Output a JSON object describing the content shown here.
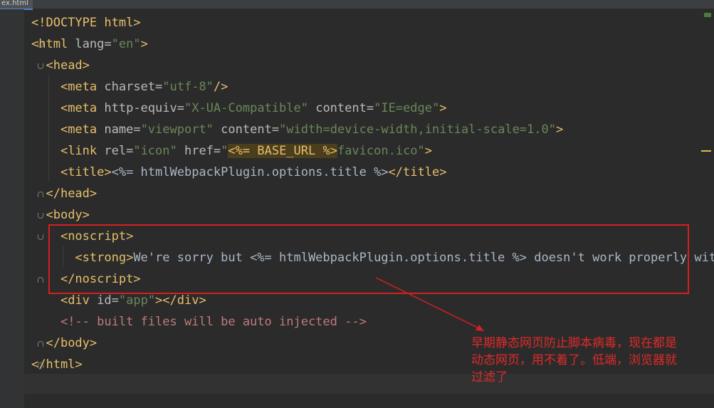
{
  "tab": {
    "label": "ex.html"
  },
  "lines": [
    {
      "parts": [
        [
          "tag",
          "<!DOCTYPE "
        ],
        [
          "tag",
          "html"
        ],
        [
          "tag",
          ">"
        ]
      ]
    },
    {
      "parts": [
        [
          "tag",
          "<html "
        ],
        [
          "attr",
          "lang="
        ],
        [
          "val",
          "\"en\""
        ],
        [
          "tag",
          ">"
        ]
      ]
    },
    {
      "parts": [
        [
          "plain",
          "  "
        ],
        [
          "tag",
          "<head>"
        ]
      ]
    },
    {
      "parts": [
        [
          "plain",
          "    "
        ],
        [
          "tag",
          "<meta "
        ],
        [
          "attr",
          "charset="
        ],
        [
          "val",
          "\"utf-8\""
        ],
        [
          "tag",
          "/>"
        ]
      ]
    },
    {
      "parts": [
        [
          "plain",
          "    "
        ],
        [
          "tag",
          "<meta "
        ],
        [
          "attr",
          "http-equiv="
        ],
        [
          "val",
          "\"X-UA-Compatible\""
        ],
        [
          "attr",
          " content="
        ],
        [
          "val",
          "\"IE=edge\""
        ],
        [
          "tag",
          ">"
        ]
      ]
    },
    {
      "parts": [
        [
          "plain",
          "    "
        ],
        [
          "tag",
          "<meta "
        ],
        [
          "attr",
          "name="
        ],
        [
          "val",
          "\"viewport\""
        ],
        [
          "attr",
          " content="
        ],
        [
          "val",
          "\"width=device-width,initial-scale=1.0\""
        ],
        [
          "tag",
          ">"
        ]
      ]
    },
    {
      "parts": [
        [
          "plain",
          "    "
        ],
        [
          "tag",
          "<link "
        ],
        [
          "attr",
          "rel="
        ],
        [
          "val",
          "\"icon\""
        ],
        [
          "attr",
          " href="
        ],
        [
          "val",
          "\""
        ],
        [
          "hl",
          "<%= BASE_URL %>"
        ],
        [
          "val",
          "favicon.ico\""
        ],
        [
          "tag",
          ">"
        ]
      ]
    },
    {
      "parts": [
        [
          "plain",
          "    "
        ],
        [
          "tag",
          "<title>"
        ],
        [
          "plain",
          "<%= htmlWebpackPlugin.options.title %>"
        ],
        [
          "tag",
          "</title>"
        ]
      ]
    },
    {
      "parts": [
        [
          "plain",
          "  "
        ],
        [
          "tag",
          "</head>"
        ]
      ]
    },
    {
      "parts": [
        [
          "plain",
          "  "
        ],
        [
          "tag",
          "<body>"
        ]
      ]
    },
    {
      "parts": [
        [
          "plain",
          "    "
        ],
        [
          "tag",
          "<noscript>"
        ]
      ]
    },
    {
      "parts": [
        [
          "plain",
          "      "
        ],
        [
          "tag",
          "<strong>"
        ],
        [
          "plain",
          "We're sorry but <%= htmlWebpackPlugin.options.title %> doesn't work properly with"
        ]
      ]
    },
    {
      "parts": [
        [
          "plain",
          "    "
        ],
        [
          "tag",
          "</noscript>"
        ]
      ]
    },
    {
      "parts": [
        [
          "plain",
          "    "
        ],
        [
          "tag",
          "<div "
        ],
        [
          "attr",
          "id="
        ],
        [
          "val",
          "\"app\""
        ],
        [
          "tag",
          "></div>"
        ]
      ]
    },
    {
      "parts": [
        [
          "plain",
          "    "
        ],
        [
          "cmt",
          "<!-- built files will be auto injected -->"
        ]
      ]
    },
    {
      "parts": [
        [
          "plain",
          "  "
        ],
        [
          "tag",
          "</body>"
        ]
      ]
    },
    {
      "parts": [
        [
          "tag",
          "</html>"
        ]
      ]
    }
  ],
  "annotation": {
    "text": "早期静态网页防止脚本病毒，现在都是动态网页，用不着了。低端，浏览器就过滤了"
  }
}
